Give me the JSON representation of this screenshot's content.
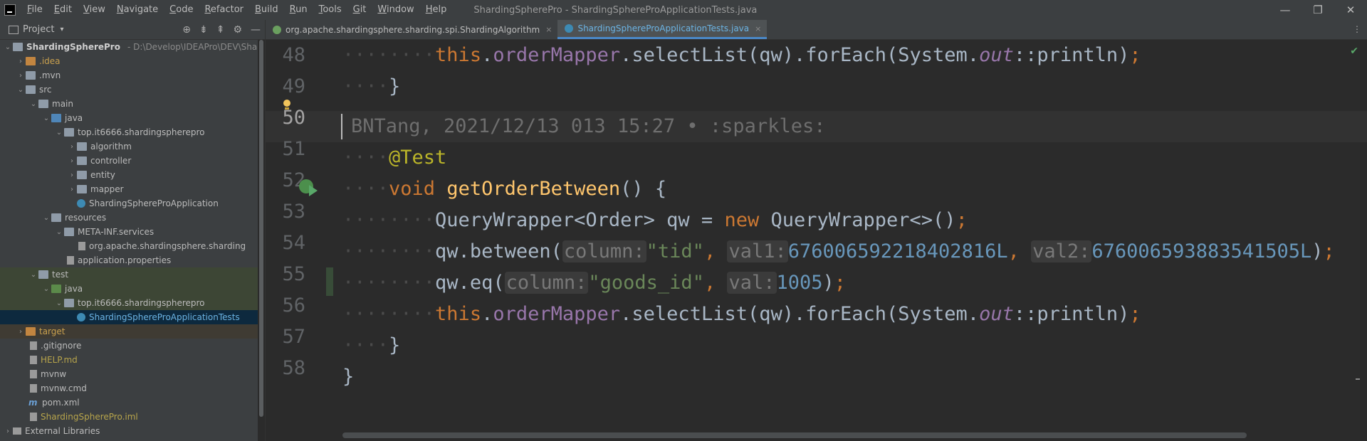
{
  "menu": {
    "items": [
      "File",
      "Edit",
      "View",
      "Navigate",
      "Code",
      "Refactor",
      "Build",
      "Run",
      "Tools",
      "Git",
      "Window",
      "Help"
    ],
    "window_title": "ShardingSpherePro - ShardingSphereProApplicationTests.java"
  },
  "window_controls": {
    "minimize": "—",
    "restore": "❐",
    "close": "✕"
  },
  "project_panel": {
    "title": "Project",
    "caret": "▾",
    "tools": {
      "target": "⊕",
      "collapse": "⇟",
      "expand": "⇞",
      "settings": "⚙",
      "hide": "—"
    }
  },
  "tree": [
    {
      "arrow": "⌄",
      "icon": "folder",
      "label": "ShardingSpherePro",
      "path": "- D:\\Develop\\IDEAPro\\DEV\\Sha",
      "style": "bold"
    },
    {
      "arrow": "›",
      "icon": "folder-orange",
      "label": ".idea",
      "style": "orange"
    },
    {
      "arrow": "›",
      "icon": "folder",
      "label": ".mvn",
      "style": ""
    },
    {
      "arrow": "⌄",
      "icon": "folder",
      "label": "src",
      "style": ""
    },
    {
      "arrow": "⌄",
      "icon": "folder",
      "label": "main",
      "style": ""
    },
    {
      "arrow": "⌄",
      "icon": "folder-blue",
      "label": "java",
      "style": ""
    },
    {
      "arrow": "⌄",
      "icon": "folder",
      "label": "top.it6666.shardingspherepro",
      "style": ""
    },
    {
      "arrow": "›",
      "icon": "folder",
      "label": "algorithm",
      "style": ""
    },
    {
      "arrow": "›",
      "icon": "folder",
      "label": "controller",
      "style": ""
    },
    {
      "arrow": "›",
      "icon": "folder",
      "label": "entity",
      "style": ""
    },
    {
      "arrow": "›",
      "icon": "folder",
      "label": "mapper",
      "style": ""
    },
    {
      "arrow": "",
      "icon": "class",
      "label": "ShardingSphereProApplication",
      "style": ""
    },
    {
      "arrow": "⌄",
      "icon": "folder-res",
      "label": "resources",
      "style": ""
    },
    {
      "arrow": "⌄",
      "icon": "folder",
      "label": "META-INF.services",
      "style": ""
    },
    {
      "arrow": "",
      "icon": "file",
      "label": "org.apache.shardingsphere.sharding",
      "style": ""
    },
    {
      "arrow": "",
      "icon": "file",
      "label": "application.properties",
      "style": ""
    },
    {
      "arrow": "⌄",
      "icon": "folder",
      "label": "test",
      "style": ""
    },
    {
      "arrow": "⌄",
      "icon": "folder-green",
      "label": "java",
      "style": ""
    },
    {
      "arrow": "⌄",
      "icon": "folder",
      "label": "top.it6666.shardingspherepro",
      "style": ""
    },
    {
      "arrow": "",
      "icon": "class",
      "label": "ShardingSphereProApplicationTests",
      "style": ""
    },
    {
      "arrow": "›",
      "icon": "folder-orange",
      "label": "target",
      "style": "orange"
    },
    {
      "arrow": "",
      "icon": "file",
      "label": ".gitignore",
      "style": ""
    },
    {
      "arrow": "",
      "icon": "file-md",
      "label": "HELP.md",
      "style": "yellow"
    },
    {
      "arrow": "",
      "icon": "file",
      "label": "mvnw",
      "style": ""
    },
    {
      "arrow": "",
      "icon": "file",
      "label": "mvnw.cmd",
      "style": ""
    },
    {
      "arrow": "",
      "icon": "file-m",
      "label": "pom.xml",
      "style": ""
    },
    {
      "arrow": "",
      "icon": "file",
      "label": "ShardingSpherePro.iml",
      "style": "yellow"
    },
    {
      "arrow": "›",
      "icon": "lib",
      "label": "External Libraries",
      "style": ""
    }
  ],
  "tabs": [
    {
      "label": "org.apache.shardingsphere.sharding.spi.ShardingAlgorithm",
      "close": "×",
      "active": false
    },
    {
      "label": "ShardingSphereProApplicationTests.java",
      "close": "×",
      "active": true
    }
  ],
  "tab_more": "⋮",
  "editor": {
    "line_numbers": [
      "48",
      "49",
      "50",
      "51",
      "52",
      "53",
      "54",
      "55",
      "56",
      "57",
      "58"
    ],
    "current_line": "50",
    "blame": "BNTang, 2021/12/13 013 15:27 • :sparkles:",
    "check_mark": "✔"
  }
}
